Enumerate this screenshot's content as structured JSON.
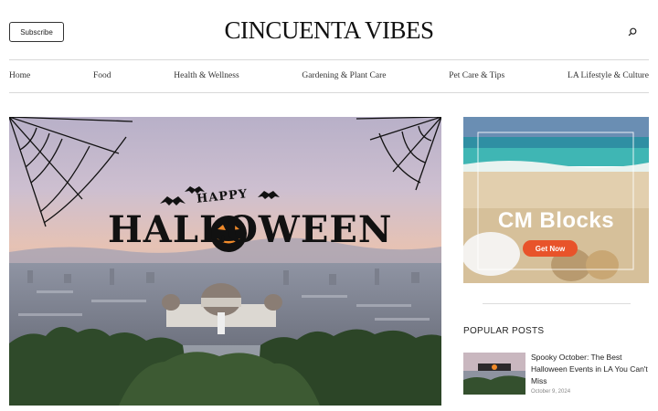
{
  "header": {
    "subscribe_label": "Subscribe",
    "logo_text": "CINCUENTA VIBES",
    "search_icon": "search-icon"
  },
  "nav": {
    "items": [
      "Home",
      "Food",
      "Health & Wellness",
      "Gardening & Plant Care",
      "Pet Care & Tips",
      "LA Lifestyle & Culture"
    ]
  },
  "hero": {
    "overlay_small": "HAPPY",
    "overlay_big": "HALLOWEEN"
  },
  "ad": {
    "title": "CM Blocks",
    "button_label": "Get Now"
  },
  "sidebar": {
    "popular_heading": "POPULAR POSTS",
    "posts": [
      {
        "title": "Spooky October: The Best Halloween Events in LA You Can't Miss",
        "date": "October 9, 2024"
      }
    ]
  },
  "colors": {
    "accent_button": "#e8532a",
    "text": "#222222"
  }
}
